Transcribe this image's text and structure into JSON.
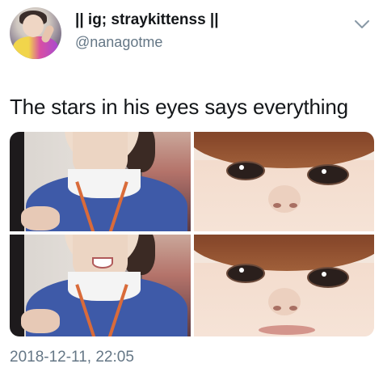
{
  "tweet": {
    "display_name": "|| ig; straykittenss ||",
    "handle": "@nanagotme",
    "text": "The stars in his eyes says everything",
    "timestamp": "2018-12-11, 22:05"
  },
  "icons": {
    "menu": "chevron-down-icon"
  },
  "colors": {
    "text": "#14171a",
    "secondary": "#657786",
    "background": "#ffffff"
  }
}
